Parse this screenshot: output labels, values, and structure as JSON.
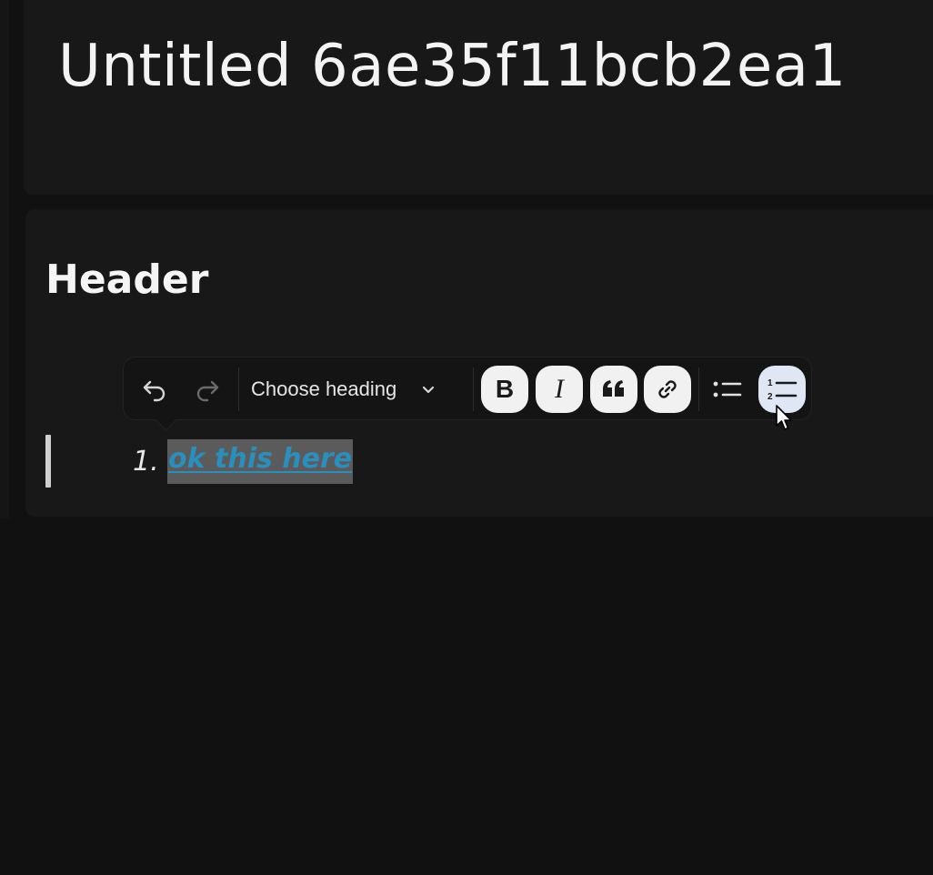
{
  "document": {
    "title": "Untitled 6ae35f11bcb2ea1"
  },
  "editor": {
    "section_heading": "Header",
    "list": [
      {
        "number": "1.",
        "text": "ok this here"
      }
    ]
  },
  "toolbar": {
    "undo_icon": "undo-icon",
    "redo_icon": "redo-icon",
    "heading_select_label": "Choose heading",
    "chevron_icon": "chevron-down-icon",
    "buttons": [
      {
        "icon": "bold-icon",
        "label": "B"
      },
      {
        "icon": "italic-icon",
        "label": "I"
      },
      {
        "icon": "quote-icon"
      },
      {
        "icon": "link-icon"
      },
      {
        "icon": "bullet-list-icon"
      },
      {
        "icon": "numbered-list-icon",
        "active": true
      }
    ]
  },
  "colors": {
    "background": "#111111",
    "card": "#181818",
    "link": "#2a8fbd",
    "selection": "#5b5b5b",
    "active_button": "#dfe7f5"
  }
}
